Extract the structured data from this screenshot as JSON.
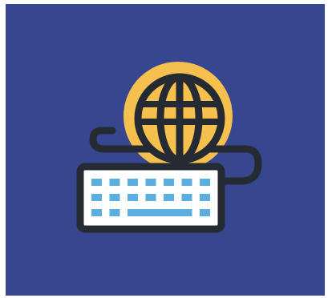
{
  "icon": {
    "name": "globe-keyboard-icon",
    "description_terms": [
      "globe",
      "keyboard",
      "cable"
    ]
  },
  "colors": {
    "background": "#36468f",
    "globe_fill": "#f6c04f",
    "outline": "#262b33",
    "keyboard_body": "#ffffff",
    "keys": "#5aaee0"
  },
  "keyboard": {
    "rows": 3,
    "keys_per_row": 7,
    "has_spacebar": true
  }
}
